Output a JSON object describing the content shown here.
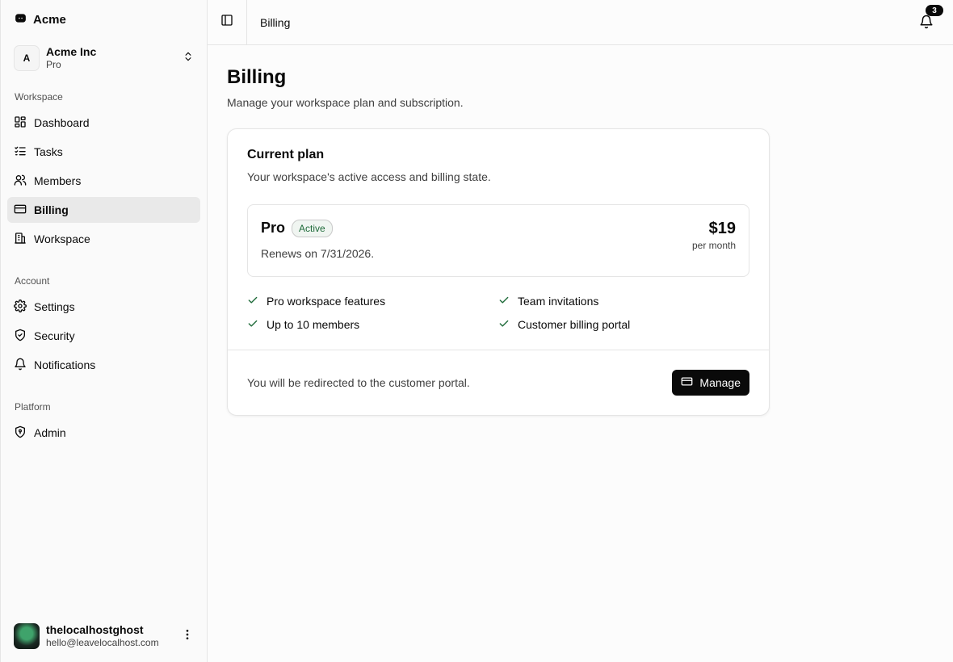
{
  "brand": {
    "name": "Acme"
  },
  "org": {
    "initial": "A",
    "name": "Acme Inc",
    "plan": "Pro"
  },
  "nav": {
    "workspace_label": "Workspace",
    "workspace_items": [
      {
        "label": "Dashboard",
        "icon": "dashboard-icon"
      },
      {
        "label": "Tasks",
        "icon": "tasks-icon"
      },
      {
        "label": "Members",
        "icon": "users-icon"
      },
      {
        "label": "Billing",
        "icon": "credit-card-icon",
        "active": true
      },
      {
        "label": "Workspace",
        "icon": "building-icon"
      }
    ],
    "account_label": "Account",
    "account_items": [
      {
        "label": "Settings",
        "icon": "gear-icon"
      },
      {
        "label": "Security",
        "icon": "shield-icon"
      },
      {
        "label": "Notifications",
        "icon": "bell-icon"
      }
    ],
    "platform_label": "Platform",
    "platform_items": [
      {
        "label": "Admin",
        "icon": "shield-alert-icon"
      }
    ]
  },
  "user": {
    "name": "thelocalhostghost",
    "email": "hello@leavelocalhost.com"
  },
  "topbar": {
    "breadcrumb": "Billing",
    "notification_count": "3"
  },
  "page": {
    "title": "Billing",
    "subtitle": "Manage your workspace plan and subscription."
  },
  "plan_card": {
    "title": "Current plan",
    "description": "Your workspace's active access and billing state.",
    "plan_name": "Pro",
    "status": "Active",
    "renews": "Renews on 7/31/2026.",
    "price": "$19",
    "period": "per month",
    "features": [
      "Pro workspace features",
      "Team invitations",
      "Up to 10 members",
      "Customer billing portal"
    ],
    "footer_note": "You will be redirected to the customer portal.",
    "manage_label": "Manage"
  },
  "colors": {
    "accent": "#0a0a0a",
    "success": "#1f6b3a",
    "active_nav_bg": "#e9e9e9"
  }
}
